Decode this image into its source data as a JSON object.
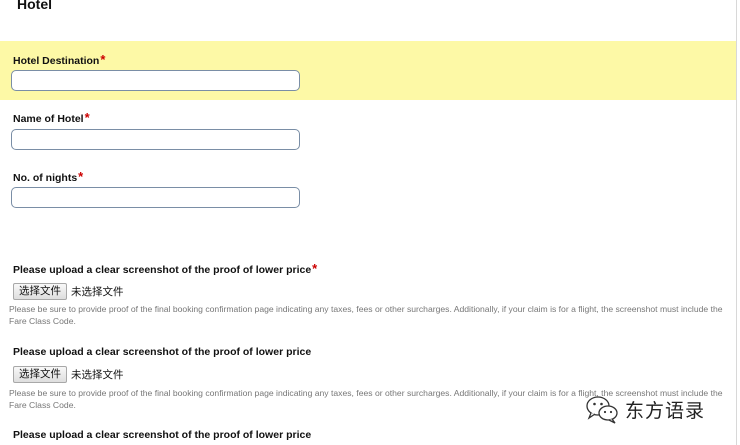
{
  "section": {
    "title": "Hotel"
  },
  "fields": {
    "destination": {
      "label": "Hotel Destination",
      "required": "*",
      "value": ""
    },
    "hotel_name": {
      "label": "Name of Hotel",
      "required": "*",
      "value": ""
    },
    "nights": {
      "label": "No. of nights",
      "required": "*",
      "value": ""
    }
  },
  "uploads": [
    {
      "label": "Please upload a clear screenshot of the proof of lower price",
      "required": "*",
      "button_label": "选择文件",
      "status": "未选择文件",
      "help": "Please be sure to provide proof of the final booking confirmation page indicating any taxes, fees or other surcharges. Additionally, if your claim is for a flight, the screenshot must include the Fare Class Code."
    },
    {
      "label": "Please upload a clear screenshot of the proof of lower price",
      "button_label": "选择文件",
      "status": "未选择文件",
      "help": "Please be sure to provide proof of the final booking confirmation page indicating any taxes, fees or other surcharges. Additionally, if your claim is for a flight, the screenshot must include the Fare Class Code."
    },
    {
      "label": "Please upload a clear screenshot of the proof of lower price"
    }
  ],
  "watermark": {
    "text": "东方语录",
    "icon": "wechat-logo-icon"
  },
  "colors": {
    "highlight": "#fdf9a6",
    "required": "#cc0000",
    "input_border": "#7a8ea6"
  }
}
